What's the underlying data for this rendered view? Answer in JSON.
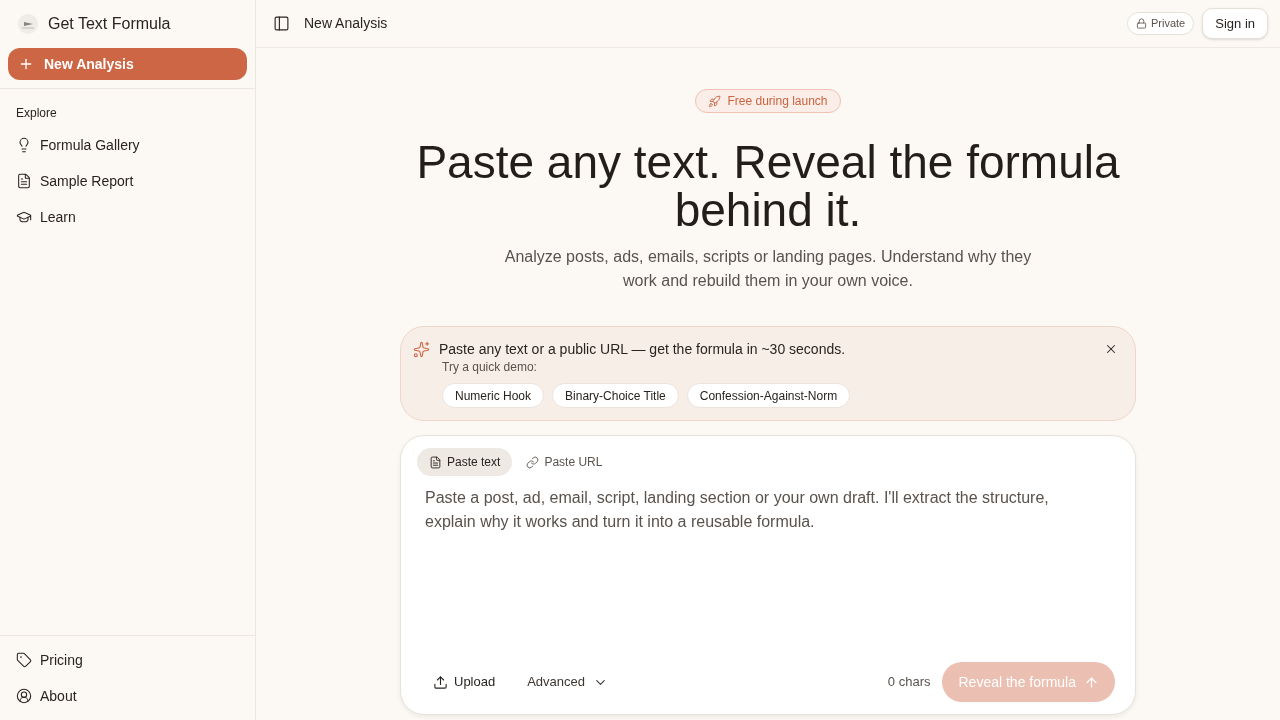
{
  "sidebar": {
    "brand": "Get Text Formula",
    "new_button": "New Analysis",
    "section_title": "Explore",
    "items": [
      {
        "label": "Formula Gallery"
      },
      {
        "label": "Sample Report"
      },
      {
        "label": "Learn"
      }
    ],
    "footer_items": [
      {
        "label": "Pricing"
      },
      {
        "label": "About"
      }
    ]
  },
  "header": {
    "title": "New Analysis",
    "privacy_badge": "Private",
    "sign_in": "Sign in"
  },
  "hero": {
    "badge": "Free during launch",
    "title": "Paste any text. Reveal the formula behind it.",
    "subtitle": "Analyze posts, ads, emails, scripts or landing pages. Understand why they work and rebuild them in your own voice."
  },
  "notice": {
    "message": "Paste any text or a public URL — get the formula in ~30 seconds.",
    "demo_label": "Try a quick demo:",
    "demos": [
      "Numeric Hook",
      "Binary-Choice Title",
      "Confession-Against-Norm"
    ]
  },
  "composer": {
    "tabs": [
      {
        "label": "Paste text",
        "selected": true
      },
      {
        "label": "Paste URL",
        "selected": false
      }
    ],
    "placeholder": "Paste a post, ad, email, script, landing section or your own draft. I'll extract the structure, explain why it works and turn it into a reusable formula.",
    "upload": "Upload",
    "advanced": "Advanced",
    "char_count": "0 chars",
    "submit": {
      "label": "Reveal the formula",
      "disabled": true
    }
  }
}
